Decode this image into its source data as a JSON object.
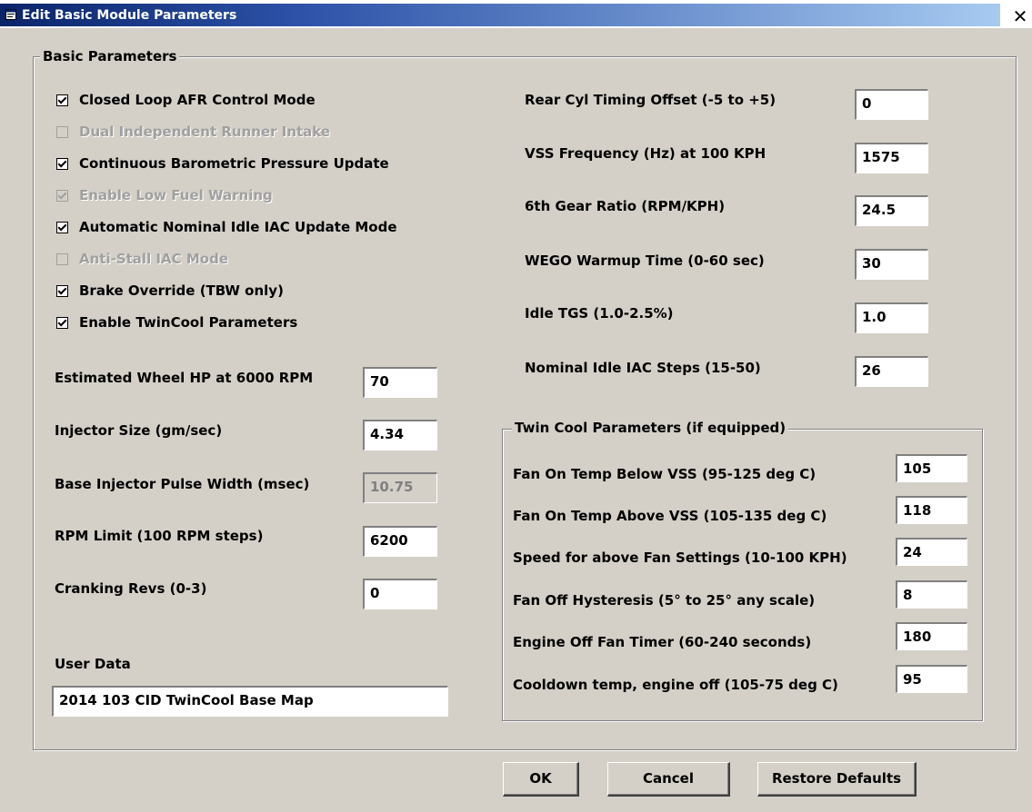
{
  "window": {
    "title": "Edit Basic Module Parameters",
    "close_glyph": "✕",
    "icon": "window-icon"
  },
  "basic_group": {
    "legend": "Basic Parameters"
  },
  "checkboxes": [
    {
      "label": "Closed Loop AFR Control Mode",
      "checked": true,
      "enabled": true
    },
    {
      "label": "Dual Independent Runner Intake",
      "checked": false,
      "enabled": false
    },
    {
      "label": "Continuous Barometric Pressure Update",
      "checked": true,
      "enabled": true
    },
    {
      "label": "Enable Low Fuel Warning",
      "checked": true,
      "enabled": false
    },
    {
      "label": "Automatic Nominal Idle IAC Update Mode",
      "checked": true,
      "enabled": true
    },
    {
      "label": "Anti-Stall IAC Mode",
      "checked": false,
      "enabled": false
    },
    {
      "label": "Brake Override (TBW only)",
      "checked": true,
      "enabled": true
    },
    {
      "label": "Enable TwinCool Parameters",
      "checked": true,
      "enabled": true
    }
  ],
  "left_fields": [
    {
      "label": "Estimated Wheel HP at 6000 RPM",
      "value": "70",
      "enabled": true
    },
    {
      "label": "Injector Size (gm/sec)",
      "value": "4.34",
      "enabled": true
    },
    {
      "label": "Base Injector Pulse Width (msec)",
      "value": "10.75",
      "enabled": false
    },
    {
      "label": "RPM Limit (100 RPM steps)",
      "value": "6200",
      "enabled": true
    },
    {
      "label": "Cranking Revs (0-3)",
      "value": "0",
      "enabled": true
    }
  ],
  "user_data": {
    "label": "User Data",
    "value": "2014 103 CID TwinCool Base Map"
  },
  "right_fields": [
    {
      "label": "Rear Cyl Timing Offset (-5 to +5)",
      "value": "0"
    },
    {
      "label": "VSS Frequency (Hz)  at 100 KPH",
      "value": "1575"
    },
    {
      "label": "6th Gear Ratio (RPM/KPH)",
      "value": "24.5"
    },
    {
      "label": "WEGO Warmup Time (0-60 sec)",
      "value": "30"
    },
    {
      "label": "Idle TGS (1.0-2.5%)",
      "value": "1.0"
    },
    {
      "label": "Nominal Idle IAC Steps (15-50)",
      "value": "26"
    }
  ],
  "twin_group": {
    "legend": "Twin Cool Parameters (if equipped)",
    "fields": [
      {
        "label": "Fan On Temp Below VSS (95-125 deg C)",
        "value": "105"
      },
      {
        "label": "Fan On Temp Above VSS (105-135 deg C)",
        "value": "118"
      },
      {
        "label": "Speed for above Fan Settings (10-100 KPH)",
        "value": "24"
      },
      {
        "label": "Fan Off Hysteresis (5° to 25° any scale)",
        "value": "8"
      },
      {
        "label": "Engine Off Fan Timer (60-240 seconds)",
        "value": "180"
      },
      {
        "label": "Cooldown temp, engine off (105-75 deg C)",
        "value": "95"
      }
    ]
  },
  "buttons": {
    "ok": "OK",
    "cancel": "Cancel",
    "restore": "Restore Defaults"
  }
}
